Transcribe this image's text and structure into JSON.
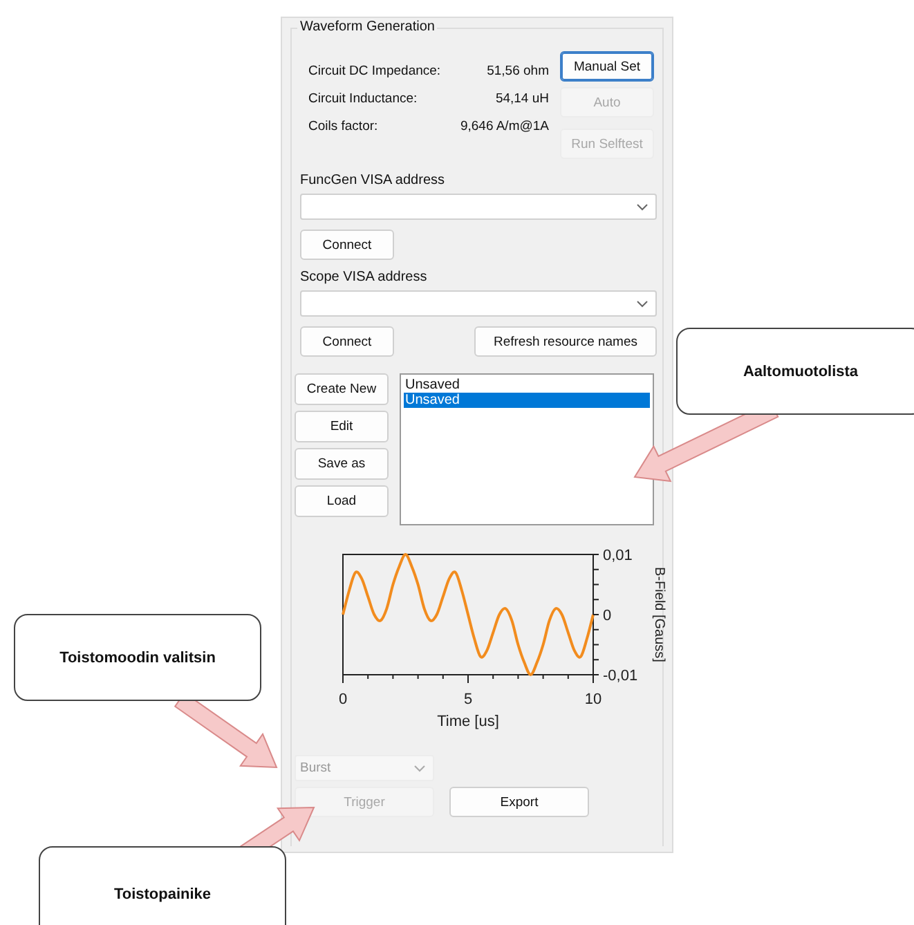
{
  "group_title": "Waveform Generation",
  "measurements": [
    {
      "label": "Circuit DC Impedance:",
      "value": "51,56 ohm"
    },
    {
      "label": "Circuit Inductance:",
      "value": "54,14 uH"
    },
    {
      "label": "Coils factor:",
      "value": "9,646 A/m@1A"
    }
  ],
  "side_buttons": [
    {
      "label": "Manual Set",
      "disabled": false,
      "focused": true
    },
    {
      "label": "Auto",
      "disabled": true,
      "focused": false
    },
    {
      "label": "Run Selftest",
      "disabled": true,
      "focused": false
    }
  ],
  "funcgen": {
    "label": "FuncGen VISA address",
    "connect": "Connect"
  },
  "scope": {
    "label": "Scope VISA address",
    "connect": "Connect",
    "refresh": "Refresh resource names"
  },
  "waveform_buttons": [
    "Create New",
    "Edit",
    "Save as",
    "Load"
  ],
  "waveform_list": [
    {
      "name": "Unsaved",
      "selected": false
    },
    {
      "name": "Unsaved",
      "selected": true
    }
  ],
  "chart_data": {
    "type": "line",
    "xlabel": "Time [us]",
    "ylabel": "B-Field [Gauss]",
    "xlim": [
      0,
      10
    ],
    "ylim": [
      -0.01,
      0.01
    ],
    "xticks": [
      0,
      5,
      10
    ],
    "yticks": [
      {
        "value": 0.01,
        "label": "0,01"
      },
      {
        "value": 0,
        "label": "0"
      },
      {
        "value": -0.01,
        "label": "-0,01"
      }
    ],
    "x": [
      0,
      0.25,
      0.5,
      0.75,
      1,
      1.25,
      1.5,
      1.75,
      2,
      2.25,
      2.5,
      2.75,
      3,
      3.25,
      3.5,
      3.75,
      4,
      4.25,
      4.5,
      4.75,
      5,
      5.25,
      5.5,
      5.75,
      6,
      6.25,
      6.5,
      6.75,
      7,
      7.25,
      7.5,
      7.75,
      8,
      8.25,
      8.5,
      8.75,
      9,
      9.25,
      9.5,
      9.75,
      10
    ],
    "series": [
      {
        "color": "#f28c1e",
        "values": [
          0,
          0.004,
          0.007,
          0.006,
          0.003,
          0,
          -0.001,
          0.001,
          0.005,
          0.008,
          0.01,
          0.008,
          0.005,
          0.001,
          -0.001,
          0,
          0.003,
          0.006,
          0.007,
          0.004,
          0,
          -0.004,
          -0.007,
          -0.006,
          -0.003,
          0,
          0.001,
          -0.001,
          -0.005,
          -0.008,
          -0.01,
          -0.008,
          -0.005,
          -0.001,
          0.001,
          0,
          -0.003,
          -0.006,
          -0.007,
          -0.004,
          0
        ]
      }
    ]
  },
  "repeat_mode": {
    "value": "Burst",
    "disabled": true
  },
  "trigger": {
    "label": "Trigger",
    "disabled": true
  },
  "export": {
    "label": "Export",
    "disabled": false
  },
  "callouts": [
    {
      "text": "Aaltomuotolista"
    },
    {
      "text": "Toistomoodin valitsin"
    },
    {
      "text": "Toistopainike"
    }
  ]
}
